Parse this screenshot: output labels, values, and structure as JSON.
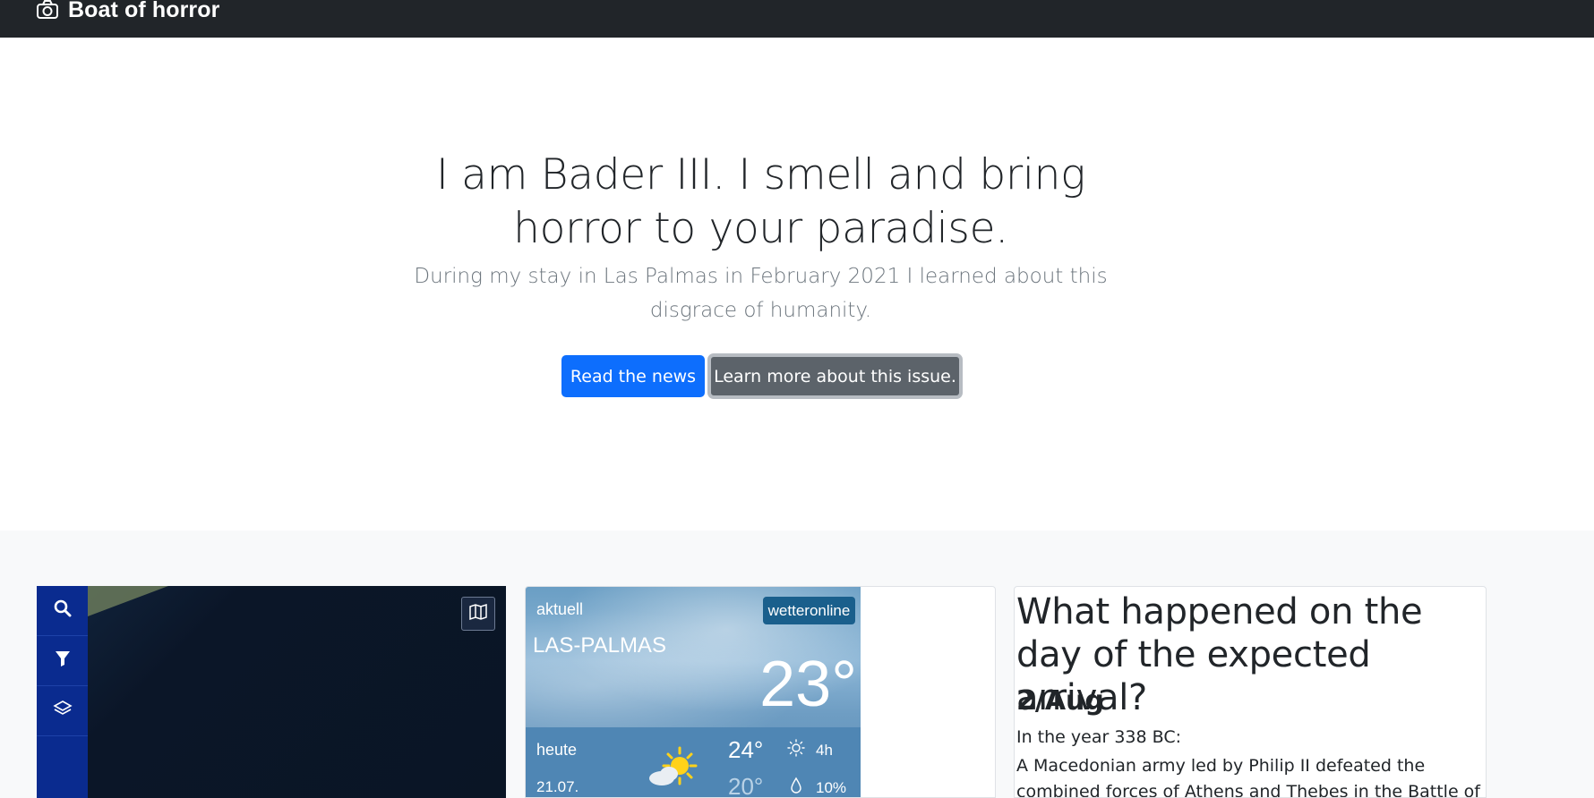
{
  "navbar": {
    "brand": "Boat of horror",
    "brand_icon": "camera-icon"
  },
  "hero": {
    "title": "I am Bader III. I smell and bring horror to your paradise.",
    "lead": "During my stay in Las Palmas in February 2021 I learned about this disgrace of humanity.",
    "primary_button": "Read the news",
    "secondary_button": "Learn more about this issue."
  },
  "map": {
    "tools": [
      "search-icon",
      "filter-icon",
      "layers-icon"
    ],
    "toggle_icon": "map-icon"
  },
  "weather": {
    "current_label": "aktuell",
    "brand": "wetteronline",
    "city": "LAS-PALMAS",
    "current_temp": "23°",
    "today_label": "heute",
    "date": "21.07.",
    "high": "24°",
    "low": "20°",
    "sunshine": "4h",
    "rain_chance": "10%",
    "condition_icon": "partly-sunny-icon"
  },
  "history": {
    "title": "What happened on the day of the expected arrival?",
    "date": "2/Aug",
    "year_line": "In the year 338 BC:",
    "body": "A Macedonian army led by Philip II defeated the combined forces of Athens and Thebes in the Battle of Chaeronea,"
  },
  "colors": {
    "navbar": "#212529",
    "primary": "#0d6efd",
    "secondary": "#5c636a",
    "section_bg": "#f8f9fa",
    "map_sidebar": "#0a2b8f"
  }
}
